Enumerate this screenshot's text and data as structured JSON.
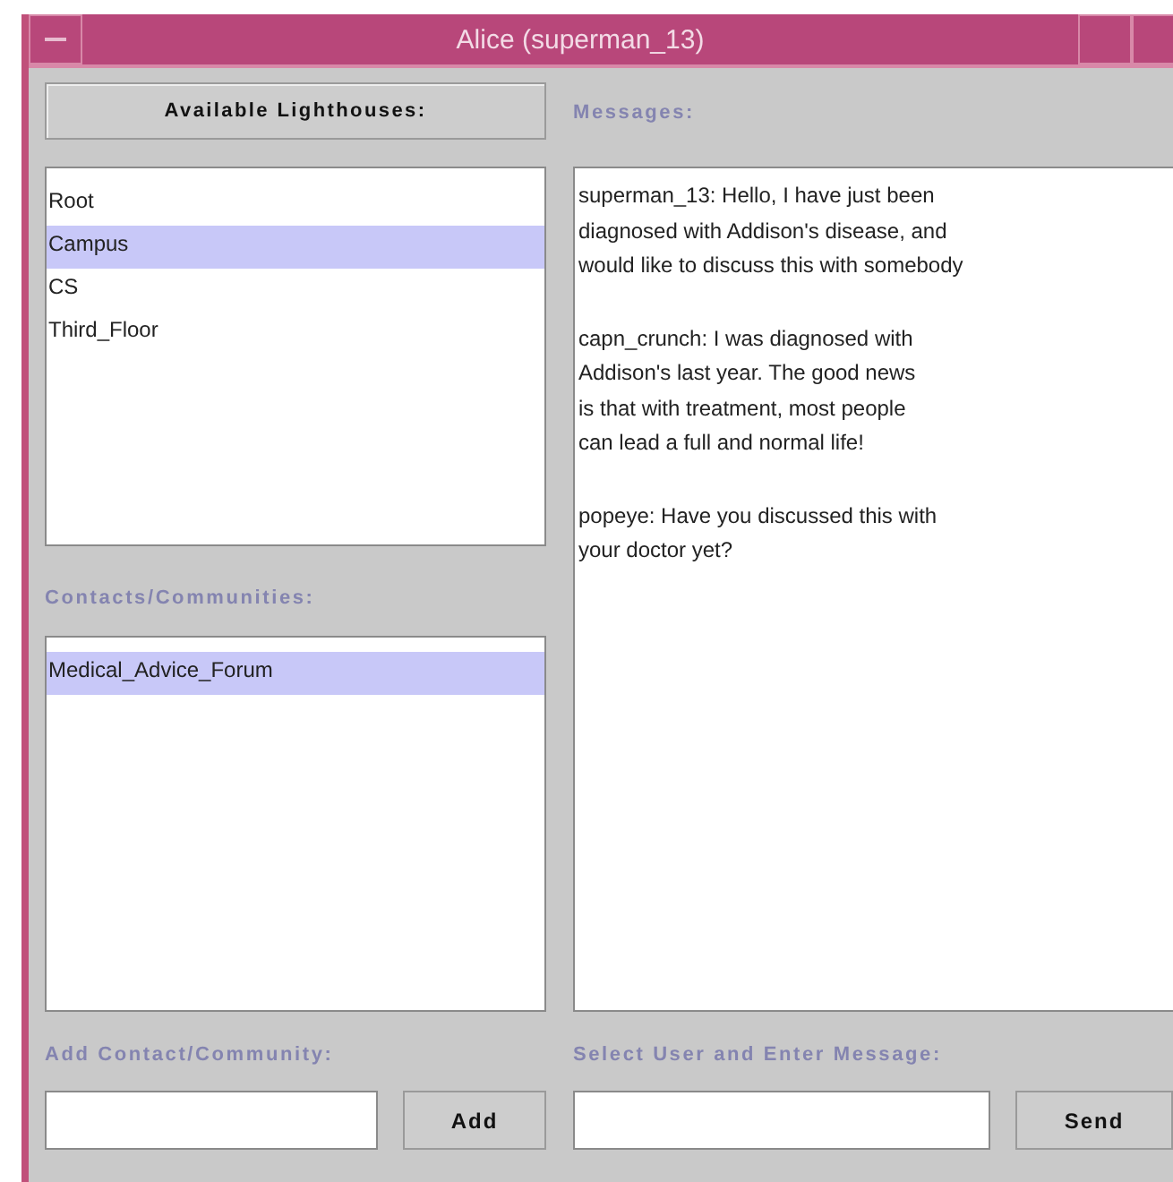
{
  "window": {
    "title": "Alice (superman_13)"
  },
  "lighthouses": {
    "button": "Available Lighthouses:",
    "items": [
      {
        "label": "Root",
        "selected": false
      },
      {
        "label": "Campus",
        "selected": true
      },
      {
        "label": "CS",
        "selected": false
      },
      {
        "label": "Third_Floor",
        "selected": false
      }
    ]
  },
  "contacts": {
    "label": "Contacts/Communities:",
    "items": [
      {
        "label": "Medical_Advice_Forum",
        "selected": true
      }
    ]
  },
  "messages": {
    "label": "Messages:",
    "items": [
      {
        "lines": [
          "superman_13: Hello, I have just been",
          "diagnosed with Addison's disease, and",
          "would like to discuss this with somebody"
        ]
      },
      {
        "lines": [
          "capn_crunch: I was diagnosed with",
          "Addison's last year. The good news",
          "is that with treatment, most people",
          "can lead a full and normal life!"
        ]
      },
      {
        "lines": [
          "popeye: Have you discussed this with",
          "your doctor yet?"
        ]
      }
    ]
  },
  "add_contact": {
    "label": "Add Contact/Community:",
    "button": "Add"
  },
  "send": {
    "label": "Select User and Enter Message:",
    "button": "Send"
  }
}
